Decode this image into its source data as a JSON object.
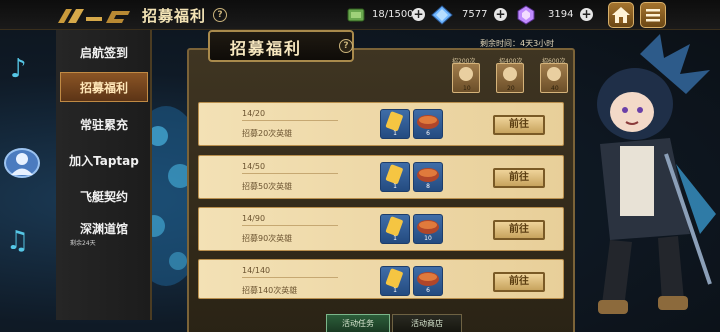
{
  "header": {
    "title": "招募福利",
    "help": "?"
  },
  "resources": [
    {
      "name": "energy",
      "value": "18/1500"
    },
    {
      "name": "crystal",
      "value": "7577"
    },
    {
      "name": "gem",
      "value": "3194"
    }
  ],
  "sidebar": {
    "items": [
      {
        "label": "启航签到"
      },
      {
        "label": "招募福利"
      },
      {
        "label": "常驻累充"
      },
      {
        "label": "加入Taptap"
      },
      {
        "label": "飞艇契约"
      },
      {
        "label": "深渊道馆",
        "sub": "剩余24天"
      }
    ]
  },
  "panel": {
    "title": "招募福利",
    "help": "?",
    "remaining": "剩余时间：4天3小时",
    "milestones": [
      {
        "label": "招200次",
        "count": "10"
      },
      {
        "label": "招400次",
        "count": "20"
      },
      {
        "label": "招600次",
        "count": "40"
      }
    ],
    "tasks": [
      {
        "progress": "14/20",
        "desc": "招募20次英雄",
        "rewards": [
          "1",
          "6"
        ],
        "button": "前往"
      },
      {
        "progress": "14/50",
        "desc": "招募50次英雄",
        "rewards": [
          "1",
          "8"
        ],
        "button": "前往"
      },
      {
        "progress": "14/90",
        "desc": "招募90次英雄",
        "rewards": [
          "1",
          "10"
        ],
        "button": "前往"
      },
      {
        "progress": "14/140",
        "desc": "招募140次英雄",
        "rewards": [
          "1",
          "6"
        ],
        "button": "前往"
      }
    ],
    "tabs": [
      {
        "label": "活动任务"
      },
      {
        "label": "活动商店"
      }
    ]
  },
  "colors": {
    "accent": "#c08a44",
    "card": "#f3e1b5",
    "button": "#efd39a"
  }
}
